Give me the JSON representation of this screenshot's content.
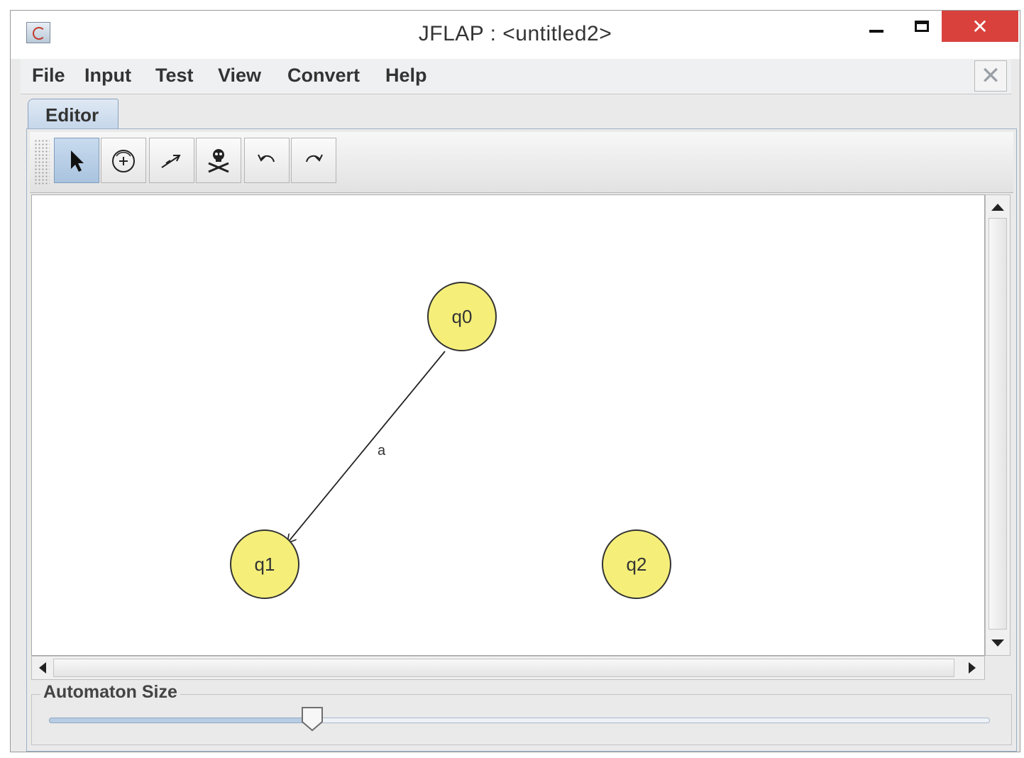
{
  "window": {
    "title": "JFLAP : <untitled2>",
    "close_symbol": "✕"
  },
  "menu": {
    "items": [
      "File",
      "Input",
      "Test",
      "View",
      "Convert",
      "Help"
    ],
    "close_symbol": "✕"
  },
  "tabs": [
    {
      "label": "Editor",
      "active": true
    }
  ],
  "toolbar": {
    "tools": [
      {
        "name": "attribute-editor",
        "icon": "arrow-pointer-icon",
        "selected": true
      },
      {
        "name": "state-creator",
        "icon": "state-add-icon",
        "selected": false
      },
      {
        "name": "transition-creator",
        "icon": "transition-arrow-icon",
        "selected": false
      },
      {
        "name": "deleter",
        "icon": "skull-crossbones-icon",
        "selected": false
      },
      {
        "name": "undo",
        "icon": "undo-icon",
        "selected": false
      },
      {
        "name": "redo",
        "icon": "redo-icon",
        "selected": false
      }
    ]
  },
  "automaton": {
    "states": [
      {
        "id": "q0",
        "label": "q0",
        "fill": "#f5ef7a"
      },
      {
        "id": "q1",
        "label": "q1",
        "fill": "#f5ef7a"
      },
      {
        "id": "q2",
        "label": "q2",
        "fill": "#f5ef7a"
      }
    ],
    "transitions": [
      {
        "from": "q0",
        "to": "q1",
        "label": "a"
      }
    ]
  },
  "size_panel": {
    "label": "Automaton Size",
    "slider_fraction": 0.28
  },
  "colors": {
    "state_fill": "#f5ef7a",
    "close_button": "#d9413d",
    "selected_tool": "#a9c3df"
  }
}
